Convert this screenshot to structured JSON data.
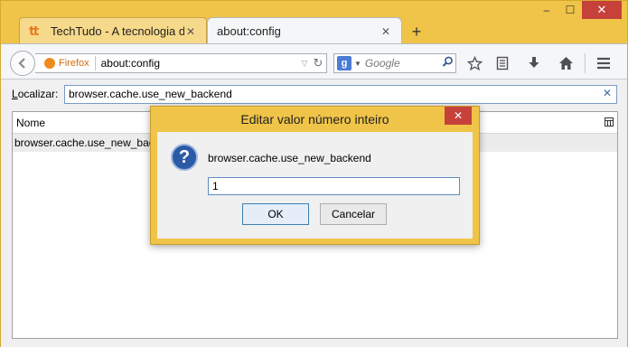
{
  "tabs": [
    {
      "title": "TechTudo - A tecnologia d...",
      "close": "✕",
      "logo": "tt"
    },
    {
      "title": "about:config",
      "close": "✕"
    }
  ],
  "caption": {
    "minimize": "–",
    "maximize": "☐",
    "close": "✕"
  },
  "newtab": "+",
  "nav": {
    "identity": "Firefox",
    "url": "about:config",
    "search_engine_letter": "g",
    "search_placeholder": "Google"
  },
  "filter": {
    "label_prefix": "L",
    "label_rest": "ocalizar:",
    "value": "browser.cache.use_new_backend",
    "clear": "✕"
  },
  "tree": {
    "column_header": "Nome",
    "rows": [
      {
        "name": "browser.cache.use_new_backend"
      }
    ]
  },
  "dialog": {
    "title": "Editar valor número inteiro",
    "close": "✕",
    "message": "browser.cache.use_new_backend",
    "input_value": "1",
    "ok_label": "OK",
    "cancel_label": "Cancelar",
    "icon": "question-icon"
  }
}
